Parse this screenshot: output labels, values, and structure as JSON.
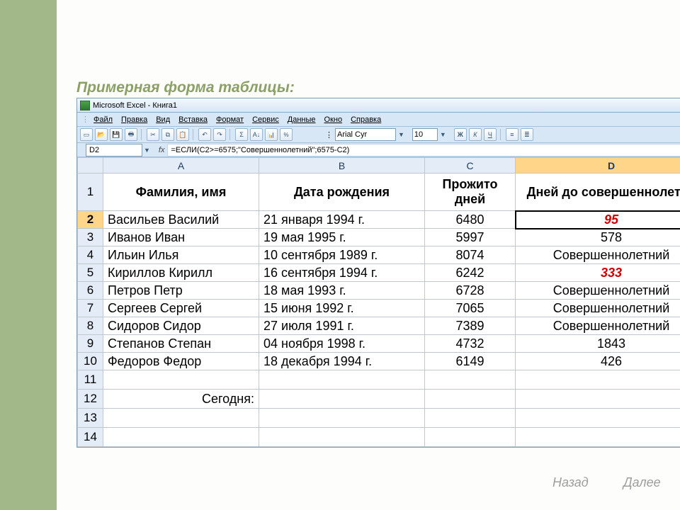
{
  "slide_title": "Примерная форма таблицы:",
  "title_bar": "Microsoft Excel - Книга1",
  "menu": [
    "Файл",
    "Правка",
    "Вид",
    "Вставка",
    "Формат",
    "Сервис",
    "Данные",
    "Окно",
    "Справка"
  ],
  "font_name": "Arial Cyr",
  "font_size": "10",
  "name_box": "D2",
  "fx": "fx",
  "formula": "=ЕСЛИ(C2>=6575;\"Совершеннолетний\";6575-C2)",
  "cols": [
    "A",
    "B",
    "C",
    "D"
  ],
  "col_selected": "D",
  "row_selected": 2,
  "headers": [
    "Фамилия, имя",
    "Дата рождения",
    "Прожито дней",
    "Дней до совершеннолетия"
  ],
  "rows": [
    {
      "n": 2,
      "a": "Васильев Василий",
      "b": "21 января 1994 г.",
      "c": "6480",
      "d": "95",
      "d_red": true
    },
    {
      "n": 3,
      "a": "Иванов Иван",
      "b": "19 мая 1995 г.",
      "c": "5997",
      "d": "578"
    },
    {
      "n": 4,
      "a": "Ильин Илья",
      "b": "10 сентября 1989 г.",
      "c": "8074",
      "d": "Совершеннолетний"
    },
    {
      "n": 5,
      "a": "Кириллов Кирилл",
      "b": "16 сентября 1994 г.",
      "c": "6242",
      "d": "333",
      "d_red": true
    },
    {
      "n": 6,
      "a": "Петров Петр",
      "b": "18 мая 1993 г.",
      "c": "6728",
      "d": "Совершеннолетний"
    },
    {
      "n": 7,
      "a": "Сергеев Сергей",
      "b": "15 июня 1992 г.",
      "c": "7065",
      "d": "Совершеннолетний"
    },
    {
      "n": 8,
      "a": "Сидоров Сидор",
      "b": "27 июля 1991 г.",
      "c": "7389",
      "d": "Совершеннолетний"
    },
    {
      "n": 9,
      "a": "Степанов Степан",
      "b": "04 ноября 1998 г.",
      "c": "4732",
      "d": "1843"
    },
    {
      "n": 10,
      "a": "Федоров Федор",
      "b": "18 декабря 1994 г.",
      "c": "6149",
      "d": "426"
    }
  ],
  "today_label": "Сегодня:",
  "nav": {
    "back": "Назад",
    "next": "Далее"
  },
  "bold": "Ж",
  "italic": "К",
  "under": "Ч"
}
